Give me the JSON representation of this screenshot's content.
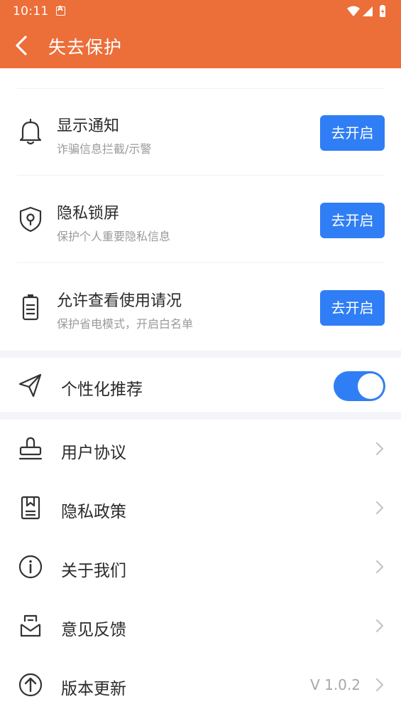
{
  "status_bar": {
    "time": "10:11"
  },
  "app_bar": {
    "title": "失去保护"
  },
  "permissions": [
    {
      "title": "显示通知",
      "subtitle": "诈骗信息拦截/示警",
      "button": "去开启",
      "icon": "bell-icon"
    },
    {
      "title": "隐私锁屏",
      "subtitle": "保护个人重要隐私信息",
      "button": "去开启",
      "icon": "shield-lock-icon"
    },
    {
      "title": "允许查看使用请况",
      "subtitle": "保护省电模式，开启白名单",
      "button": "去开启",
      "icon": "battery-icon"
    }
  ],
  "recommend": {
    "label": "个性化推荐",
    "enabled": true,
    "icon": "paper-plane-icon"
  },
  "menu": [
    {
      "label": "用户协议",
      "icon": "stamp-icon"
    },
    {
      "label": "隐私政策",
      "icon": "bookmark-book-icon"
    },
    {
      "label": "关于我们",
      "icon": "info-icon"
    },
    {
      "label": "意见反馈",
      "icon": "feedback-mail-icon"
    },
    {
      "label": "版本更新",
      "icon": "upload-arrow-icon",
      "value": "V 1.0.2"
    }
  ],
  "colors": {
    "brand": "#ec6e39",
    "accent": "#2f7ef5"
  }
}
